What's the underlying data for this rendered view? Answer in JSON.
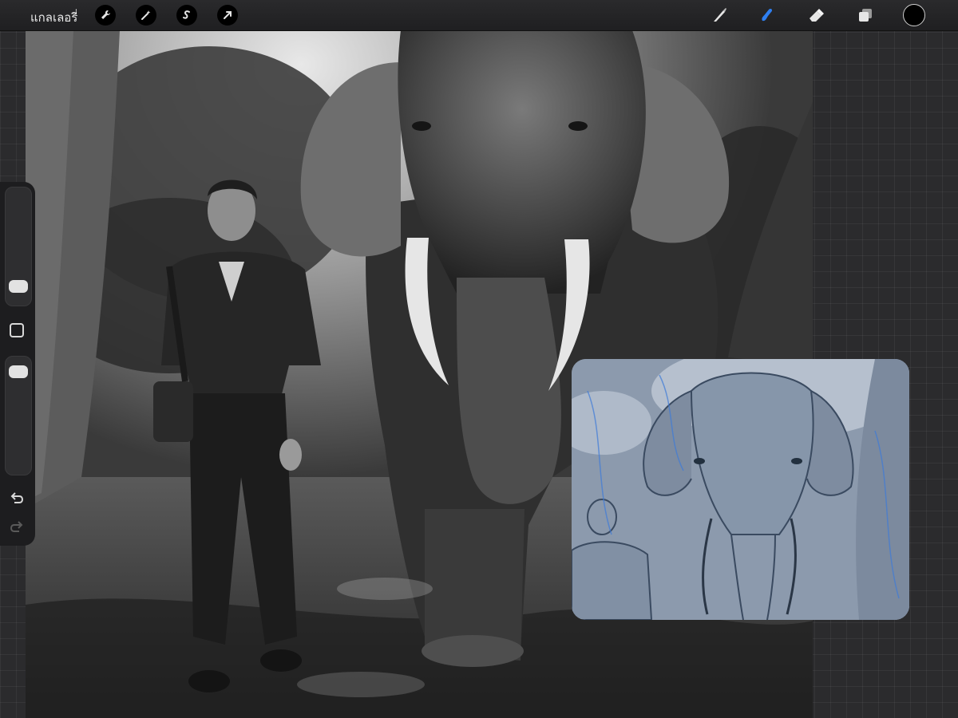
{
  "topbar": {
    "gallery_label": "แกลเลอรี่",
    "action_icons": [
      "wrench-icon",
      "magic-wand-icon",
      "selection-s-icon",
      "arrow-cursor-icon"
    ],
    "tool_icons": [
      "brush-icon",
      "smudge-icon",
      "eraser-icon",
      "layers-icon"
    ],
    "active_tool": "smudge",
    "current_color": "#000000",
    "accent_color": "#2f7ff0"
  },
  "sidebar": {
    "brush_size_level": 0.1,
    "opacity_level": 0.94,
    "icons": [
      "modify-square-icon",
      "undo-icon",
      "redo-icon"
    ]
  },
  "canvas": {
    "palette": [
      "#1a1a1a",
      "#4a4a4a",
      "#8a8a8a",
      "#d8d8d8"
    ]
  },
  "reference_window": {
    "tint": "#8c9aad",
    "line_color": "#3d7bd8"
  }
}
